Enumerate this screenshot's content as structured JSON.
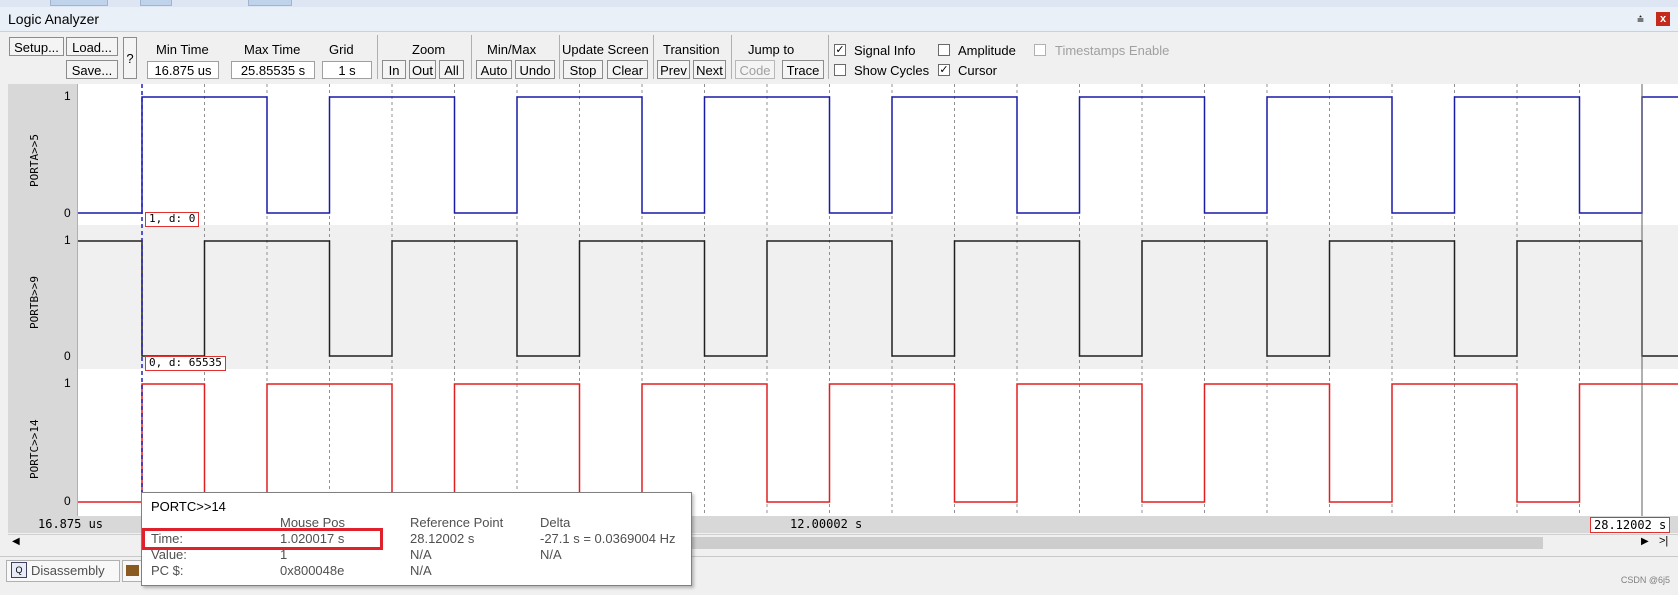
{
  "window": {
    "title": "Logic Analyzer",
    "pin_glyph": "⩮",
    "close_glyph": "x"
  },
  "toolbar": {
    "setup": "Setup...",
    "load": "Load...",
    "save": "Save...",
    "help": "?",
    "min_time_label": "Min Time",
    "min_time_value": "16.875 us",
    "max_time_label": "Max Time",
    "max_time_value": "25.85535 s",
    "grid_label": "Grid",
    "grid_value": "1 s",
    "zoom_label": "Zoom",
    "zoom_in": "In",
    "zoom_out": "Out",
    "zoom_all": "All",
    "minmax_label": "Min/Max",
    "minmax_auto": "Auto",
    "minmax_undo": "Undo",
    "update_label": "Update Screen",
    "update_stop": "Stop",
    "update_clear": "Clear",
    "transition_label": "Transition",
    "transition_prev": "Prev",
    "transition_next": "Next",
    "jump_label": "Jump to",
    "jump_code": "Code",
    "jump_trace": "Trace",
    "signal_info": {
      "label": "Signal Info",
      "checked": true
    },
    "amplitude": {
      "label": "Amplitude",
      "checked": false
    },
    "timestamps": {
      "label": "Timestamps Enable",
      "checked": false,
      "enabled": false
    },
    "show_cycles": {
      "label": "Show Cycles",
      "checked": false
    },
    "cursor": {
      "label": "Cursor",
      "checked": true
    }
  },
  "signals": [
    {
      "name": "PORTA>>5",
      "high_label": "1",
      "low_label": "0",
      "color": "#1a1aa8",
      "info": "1,  d: 0"
    },
    {
      "name": "PORTB>>9",
      "high_label": "1",
      "low_label": "0",
      "color": "#202020",
      "info": "0,  d: 65535"
    },
    {
      "name": "PORTC>>14",
      "high_label": "1",
      "low_label": "0",
      "color": "#e02020",
      "info": ""
    }
  ],
  "timeline": {
    "left": "16.875 us",
    "middle": "12.00002 s",
    "right": "28.12002 s"
  },
  "tooltip": {
    "signal": "PORTC>>14",
    "headers": {
      "mouse": "Mouse Pos",
      "ref": "Reference Point",
      "delta": "Delta"
    },
    "rows": [
      {
        "label": "Time:",
        "mouse": "1.020017 s",
        "ref": "28.12002 s",
        "delta": "-27.1 s = 0.0369004 Hz"
      },
      {
        "label": "Value:",
        "mouse": "1",
        "ref": "N/A",
        "delta": "N/A"
      },
      {
        "label": "PC $:",
        "mouse": "0x800048e",
        "ref": "N/A",
        "delta": ""
      }
    ]
  },
  "tabs": {
    "disassembly": "Disassembly"
  },
  "watermark": "CSDN @6j5"
}
